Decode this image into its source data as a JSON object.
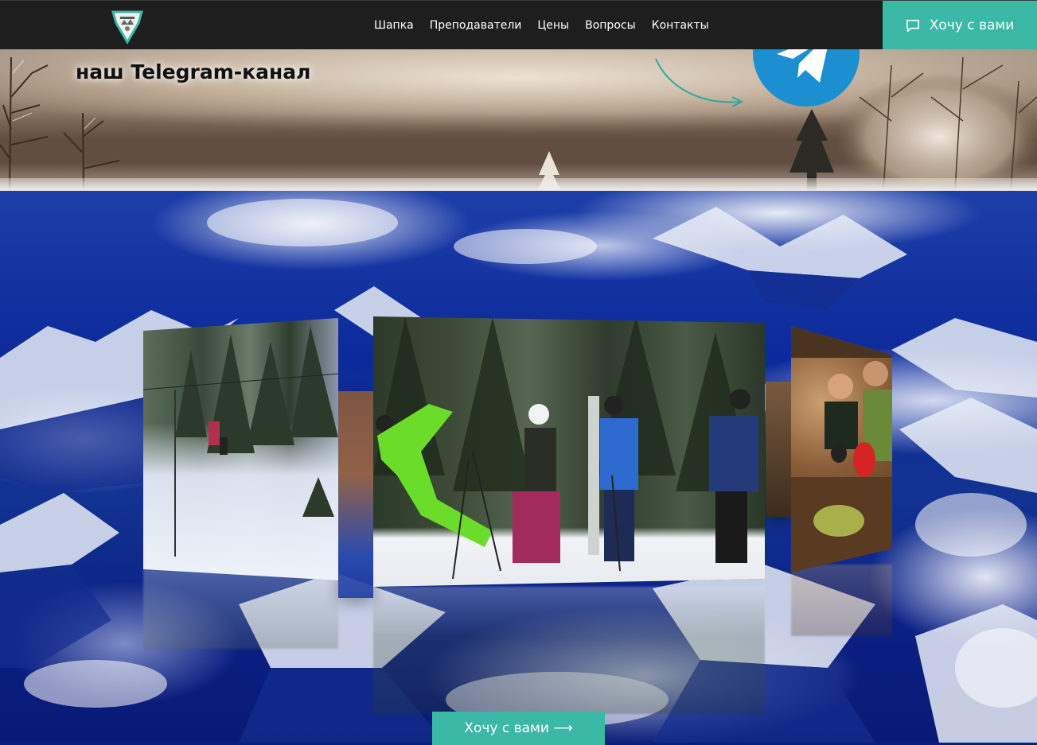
{
  "header": {
    "nav_items": [
      {
        "label": "Шапка"
      },
      {
        "label": "Преподаватели"
      },
      {
        "label": "Цены"
      },
      {
        "label": "Вопросы"
      },
      {
        "label": "Контакты"
      }
    ],
    "cta": {
      "label": "Хочу с вами",
      "icon": "chat-bubble-icon"
    },
    "logo": {
      "icon": "diamond-logo"
    }
  },
  "banner": {
    "title": "наш Telegram-канал",
    "telegram_icon": "telegram-plane-icon"
  },
  "gallery": {
    "photos": [
      {
        "subject": "ski-lift-slope"
      },
      {
        "subject": "skiers-group"
      },
      {
        "subject": "friends-restaurant"
      }
    ]
  },
  "footer_cta": {
    "label": "Хочу с вами ⟶"
  },
  "colors": {
    "accent": "#3cb8a6",
    "nav_bg": "#1e1e1e",
    "telegram": "#1b8fd0",
    "mountain_blue": "#0c2a9b"
  }
}
